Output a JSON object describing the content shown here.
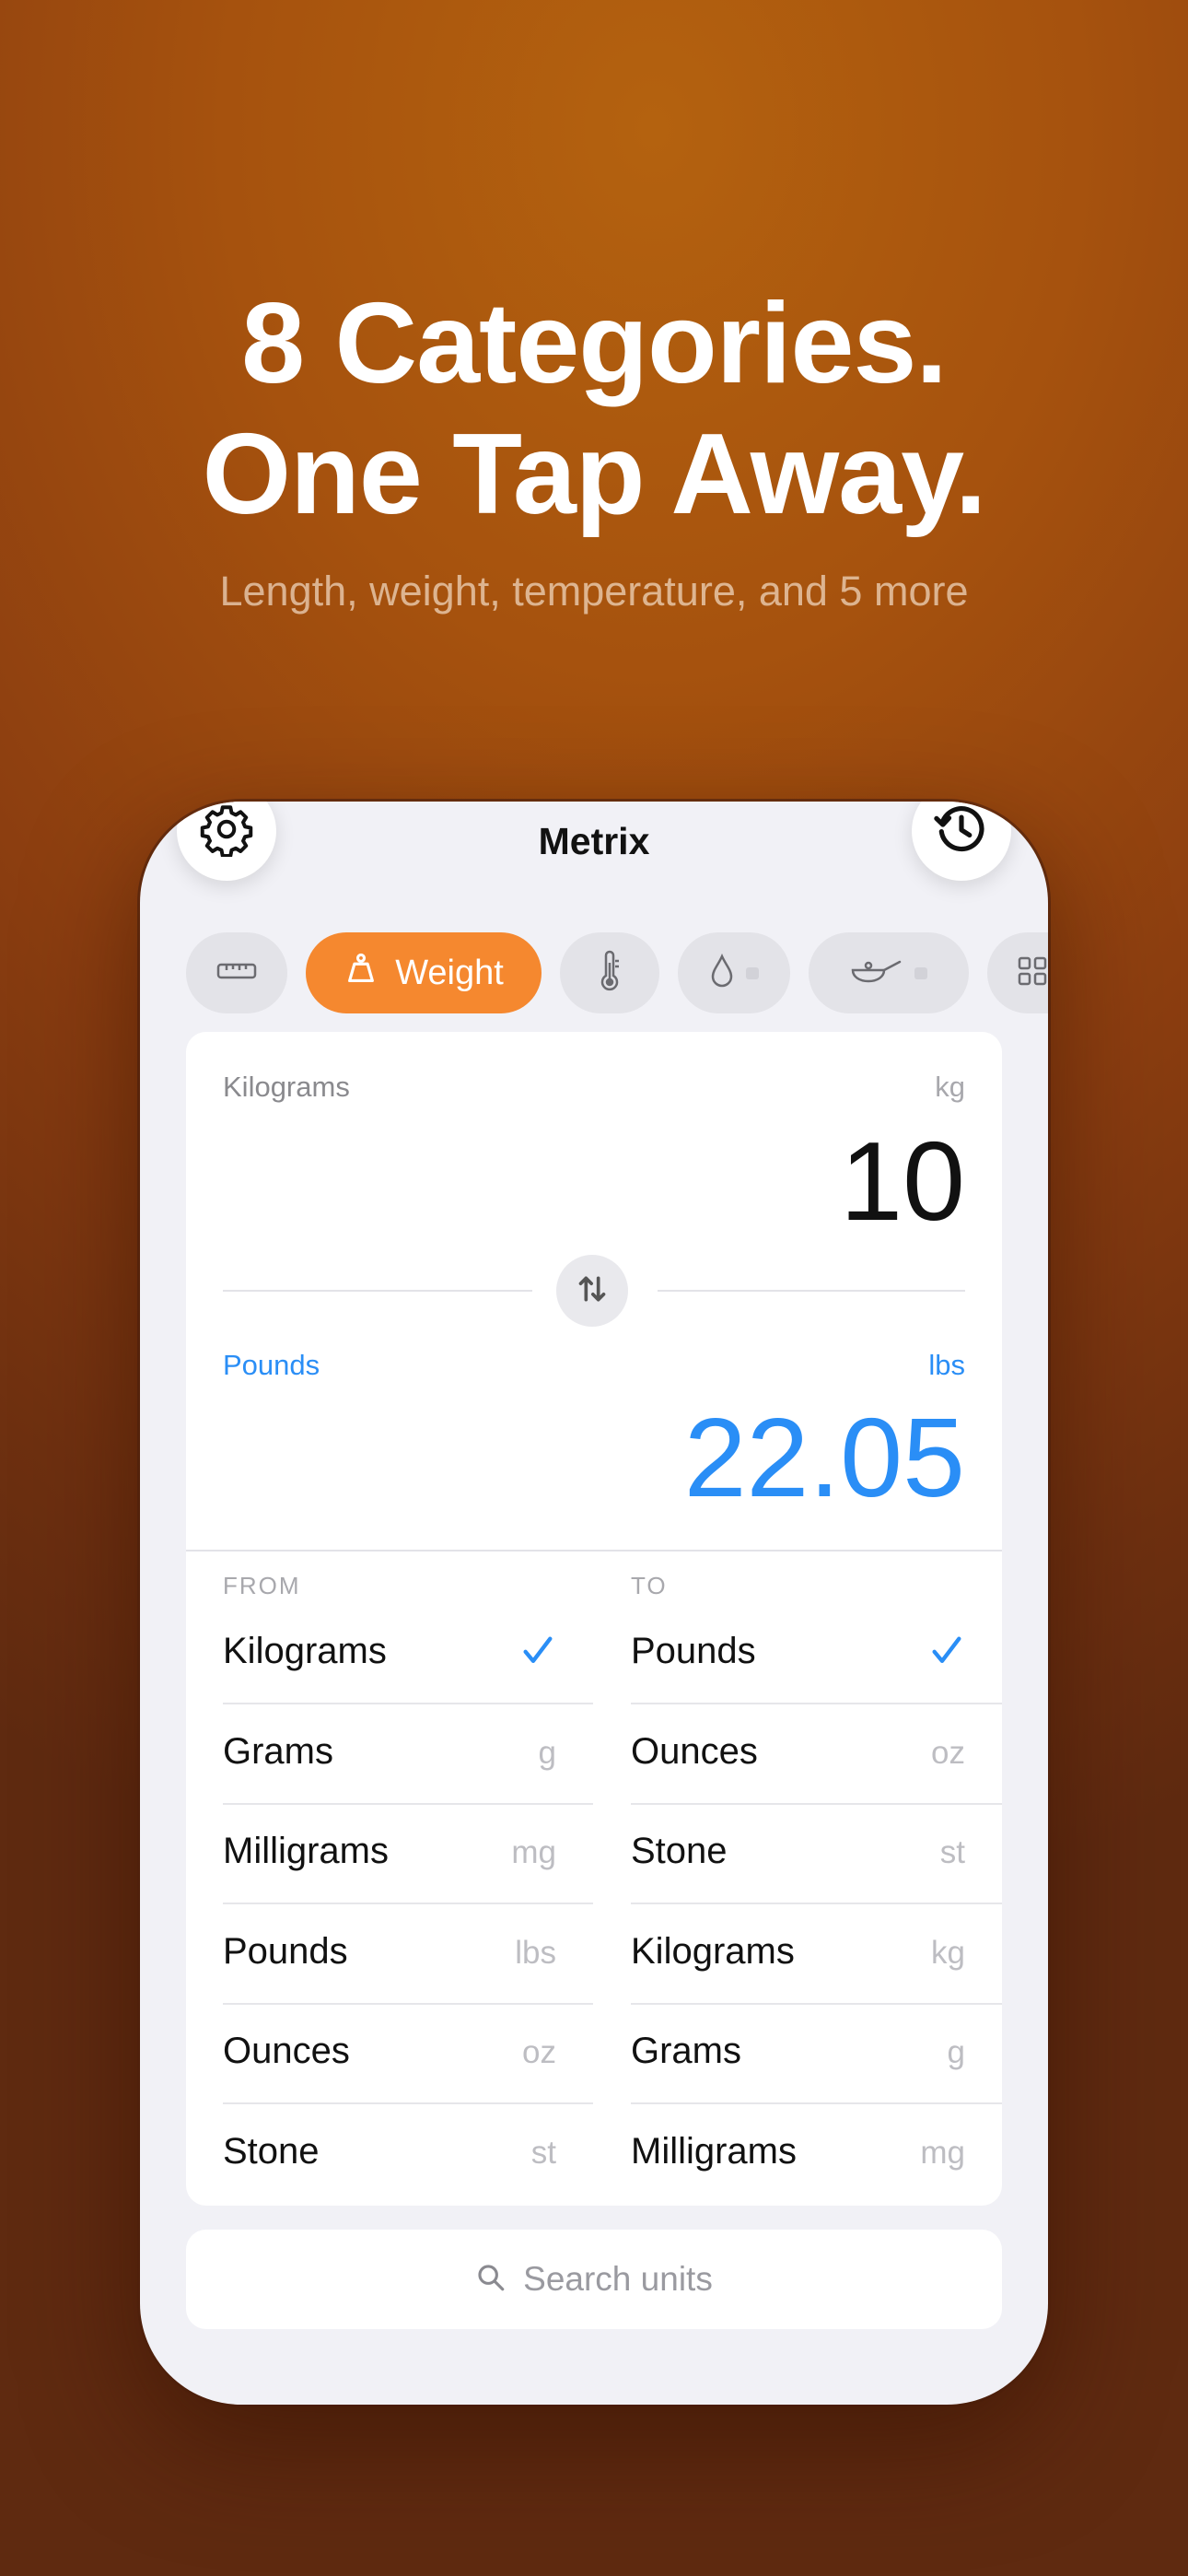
{
  "headline": {
    "line1": "8 Categories.",
    "line2": "One Tap Away."
  },
  "subhead": "Length, weight, temperature, and 5 more",
  "app": {
    "title": "Metrix",
    "settings_icon": "gear-icon",
    "history_icon": "history-clock-icon"
  },
  "categories": {
    "active_label": "Weight",
    "items": [
      {
        "icon": "ruler-icon",
        "locked": false
      },
      {
        "icon": "weight-icon",
        "label": "Weight",
        "active": true
      },
      {
        "icon": "thermometer-icon",
        "locked": false
      },
      {
        "icon": "droplet-icon",
        "locked": true
      },
      {
        "icon": "pan-icon",
        "locked": true
      },
      {
        "icon": "grid-icon",
        "locked": false
      }
    ]
  },
  "converter": {
    "from_name": "Kilograms",
    "from_unit": "kg",
    "from_value": "10",
    "to_name": "Pounds",
    "to_unit": "lbs",
    "to_value": "22.05"
  },
  "lists": {
    "from_header": "FROM",
    "to_header": "TO",
    "from": [
      {
        "name": "Kilograms",
        "abbr": "",
        "selected": true
      },
      {
        "name": "Grams",
        "abbr": "g"
      },
      {
        "name": "Milligrams",
        "abbr": "mg"
      },
      {
        "name": "Pounds",
        "abbr": "lbs"
      },
      {
        "name": "Ounces",
        "abbr": "oz"
      },
      {
        "name": "Stone",
        "abbr": "st"
      }
    ],
    "to": [
      {
        "name": "Pounds",
        "abbr": "",
        "selected": true
      },
      {
        "name": "Ounces",
        "abbr": "oz"
      },
      {
        "name": "Stone",
        "abbr": "st"
      },
      {
        "name": "Kilograms",
        "abbr": "kg"
      },
      {
        "name": "Grams",
        "abbr": "g"
      },
      {
        "name": "Milligrams",
        "abbr": "mg"
      }
    ]
  },
  "search": {
    "placeholder": "Search units"
  },
  "colors": {
    "accent": "#f5882f",
    "blue": "#2a8ef6",
    "background": "#a6520e"
  }
}
